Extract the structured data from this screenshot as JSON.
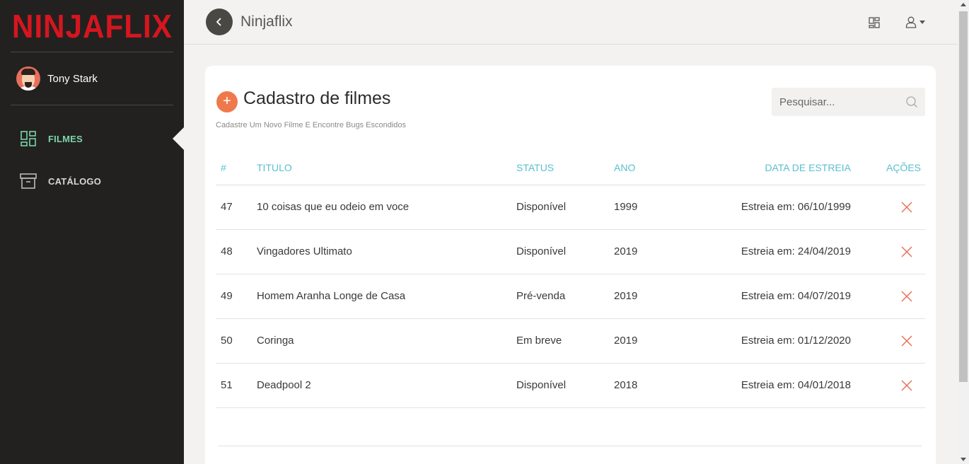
{
  "sidebar": {
    "logo": "NINJAFLIX",
    "user_name": "Tony Stark",
    "items": [
      {
        "label": "FILMES",
        "icon": "dashboard-icon",
        "active": true
      },
      {
        "label": "CATÁLOGO",
        "icon": "archive-box-icon",
        "active": false
      }
    ]
  },
  "header": {
    "title": "Ninjaflix",
    "icons": [
      "back-arrow-icon",
      "grid-icon",
      "user-icon",
      "caret-down-icon"
    ]
  },
  "card": {
    "title": "Cadastro de filmes",
    "subtitle": "Cadastre Um Novo Filme E Encontre Bugs Escondidos",
    "add_label": "+",
    "search_placeholder": "Pesquisar..."
  },
  "table": {
    "headers": {
      "id": "#",
      "title": "TITULO",
      "status": "STATUS",
      "year": "ANO",
      "date": "DATA DE ESTREIA",
      "actions": "AÇÕES"
    },
    "rows": [
      {
        "id": "47",
        "title": "10 coisas que eu odeio em voce",
        "status": "Disponível",
        "year": "1999",
        "date": "Estreia em: 06/10/1999"
      },
      {
        "id": "48",
        "title": "Vingadores Ultimato",
        "status": "Disponível",
        "year": "2019",
        "date": "Estreia em: 24/04/2019"
      },
      {
        "id": "49",
        "title": "Homem Aranha Longe de Casa",
        "status": "Pré-venda",
        "year": "2019",
        "date": "Estreia em: 04/07/2019"
      },
      {
        "id": "50",
        "title": "Coringa",
        "status": "Em breve",
        "year": "2019",
        "date": "Estreia em: 01/12/2020"
      },
      {
        "id": "51",
        "title": "Deadpool 2",
        "status": "Disponível",
        "year": "2018",
        "date": "Estreia em: 04/01/2018"
      }
    ]
  },
  "colors": {
    "sidebar_bg": "#222120",
    "logo_red": "#d6151f",
    "active_green": "#7dd3a8",
    "header_teal": "#5bbfcf",
    "add_orange": "#ee7a4c",
    "delete_red": "#e8705c"
  }
}
